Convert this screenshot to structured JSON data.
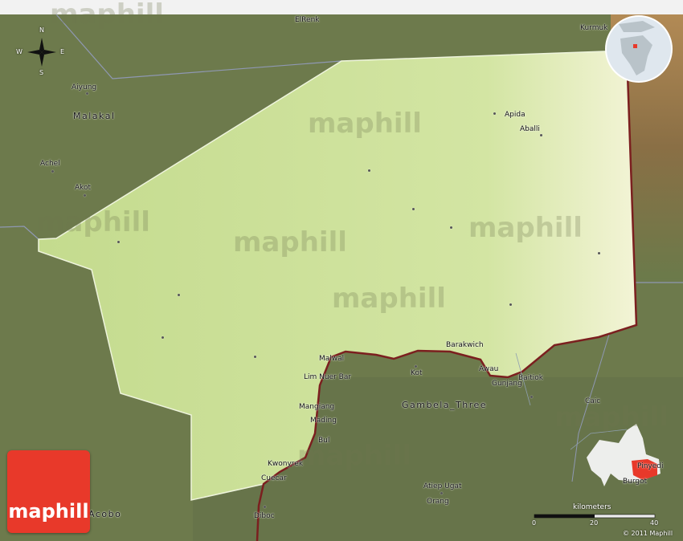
{
  "map": {
    "colors": {
      "terrain": "#6d7a4c",
      "region": "#c8dd93",
      "border_red": "#7b1f1f",
      "logo": "#e8392a"
    },
    "places": [
      {
        "name": "ElRenk",
        "style": "normal"
      },
      {
        "name": "Kurmuk",
        "style": "normal"
      },
      {
        "name": "Aiyung",
        "style": "normal"
      },
      {
        "name": "Malakal",
        "style": "big"
      },
      {
        "name": "Achel",
        "style": "normal"
      },
      {
        "name": "Akot",
        "style": "normal"
      },
      {
        "name": "Apida",
        "style": "normal"
      },
      {
        "name": "Aballi",
        "style": "normal"
      },
      {
        "name": "Barakwich",
        "style": "normal"
      },
      {
        "name": "Malwal",
        "style": "normal"
      },
      {
        "name": "Lim Nuer Bar",
        "style": "normal"
      },
      {
        "name": "Kot",
        "style": "normal"
      },
      {
        "name": "Awau",
        "style": "normal"
      },
      {
        "name": "Gunjang",
        "style": "normal"
      },
      {
        "name": "Baitiok",
        "style": "normal"
      },
      {
        "name": "Gambela_Three",
        "style": "big"
      },
      {
        "name": "Mangiang",
        "style": "normal"
      },
      {
        "name": "Mading",
        "style": "normal"
      },
      {
        "name": "Caic",
        "style": "normal"
      },
      {
        "name": "Bul",
        "style": "normal"
      },
      {
        "name": "Kwonyrek",
        "style": "normal"
      },
      {
        "name": "Cuecar",
        "style": "normal"
      },
      {
        "name": "Atiep Ugat",
        "style": "normal"
      },
      {
        "name": "Orang",
        "style": "normal"
      },
      {
        "name": "Diboc",
        "style": "normal"
      },
      {
        "name": "Acobo",
        "style": "big"
      },
      {
        "name": "Burgot",
        "style": "normal"
      },
      {
        "name": "Pinyedi",
        "style": "normal"
      }
    ],
    "watermark": "maphill",
    "compass": {
      "n": "N",
      "s": "S",
      "e": "E",
      "w": "W"
    },
    "scale": {
      "title": "kilometers",
      "ticks": [
        "0",
        "20",
        "40"
      ]
    },
    "logo_text": "maphill",
    "copyright": "© 2011 Maphill"
  }
}
